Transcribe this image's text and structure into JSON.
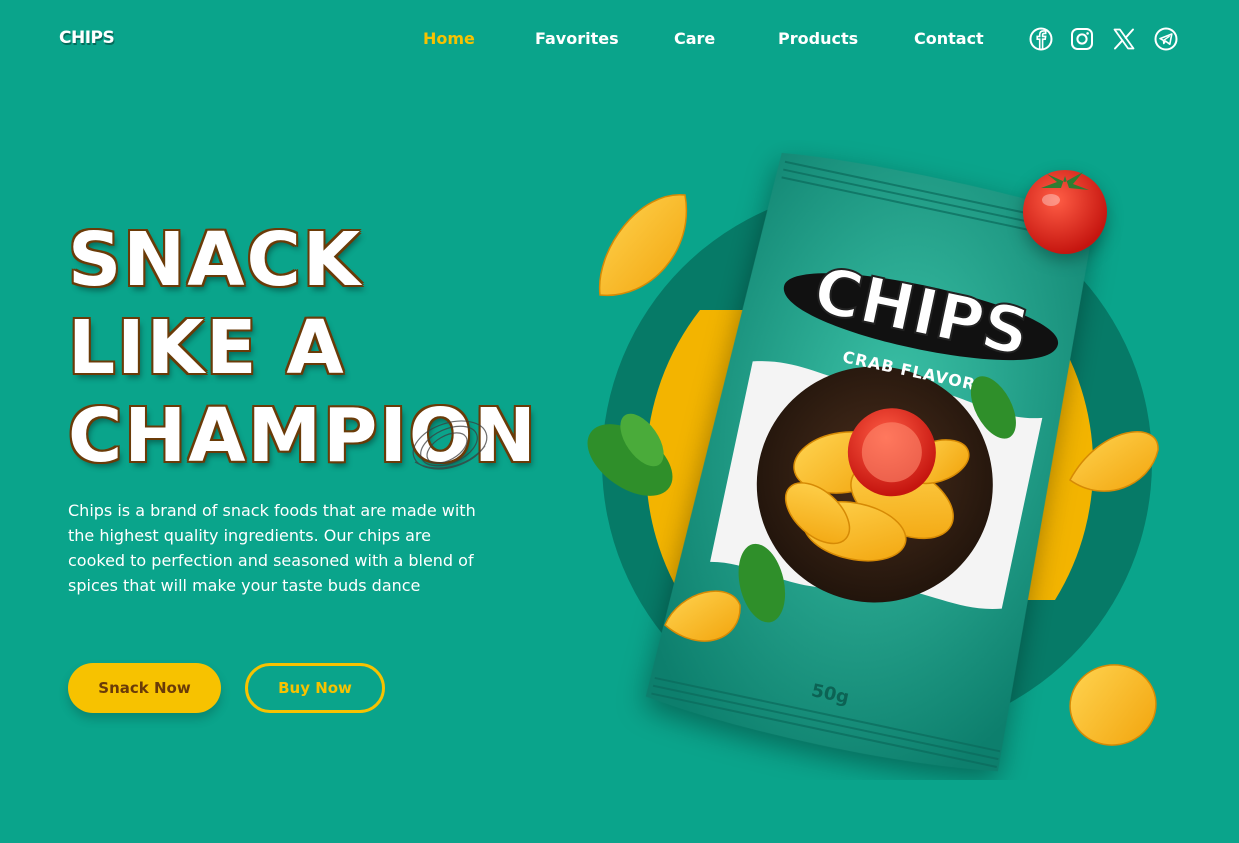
{
  "brand": {
    "logo": "CHIPS"
  },
  "nav": {
    "items": [
      {
        "label": "Home",
        "active": true
      },
      {
        "label": "Favorites",
        "active": false
      },
      {
        "label": "Care",
        "active": false
      },
      {
        "label": "Products",
        "active": false
      },
      {
        "label": "Contact",
        "active": false
      }
    ]
  },
  "social": {
    "icons": [
      "facebook-icon",
      "instagram-icon",
      "x-icon",
      "telegram-icon"
    ]
  },
  "hero": {
    "title_lines": [
      "SNACK",
      "LIKE A",
      "CHAMPION"
    ],
    "description": "Chips is a brand of snack foods that are made with the highest quality ingredients. Our chips are cooked to perfection and seasoned with a blend of spices that will make your taste buds dance",
    "primary_button": "Snack Now",
    "secondary_button": "Buy Now"
  },
  "product": {
    "bag_brand": "CHIPS",
    "bag_flavor": "CRAB FLAVOR",
    "bag_weight": "50g"
  },
  "colors": {
    "background": "#0aa48b",
    "accent": "#f7c200",
    "title_outline": "#6a3b08"
  }
}
